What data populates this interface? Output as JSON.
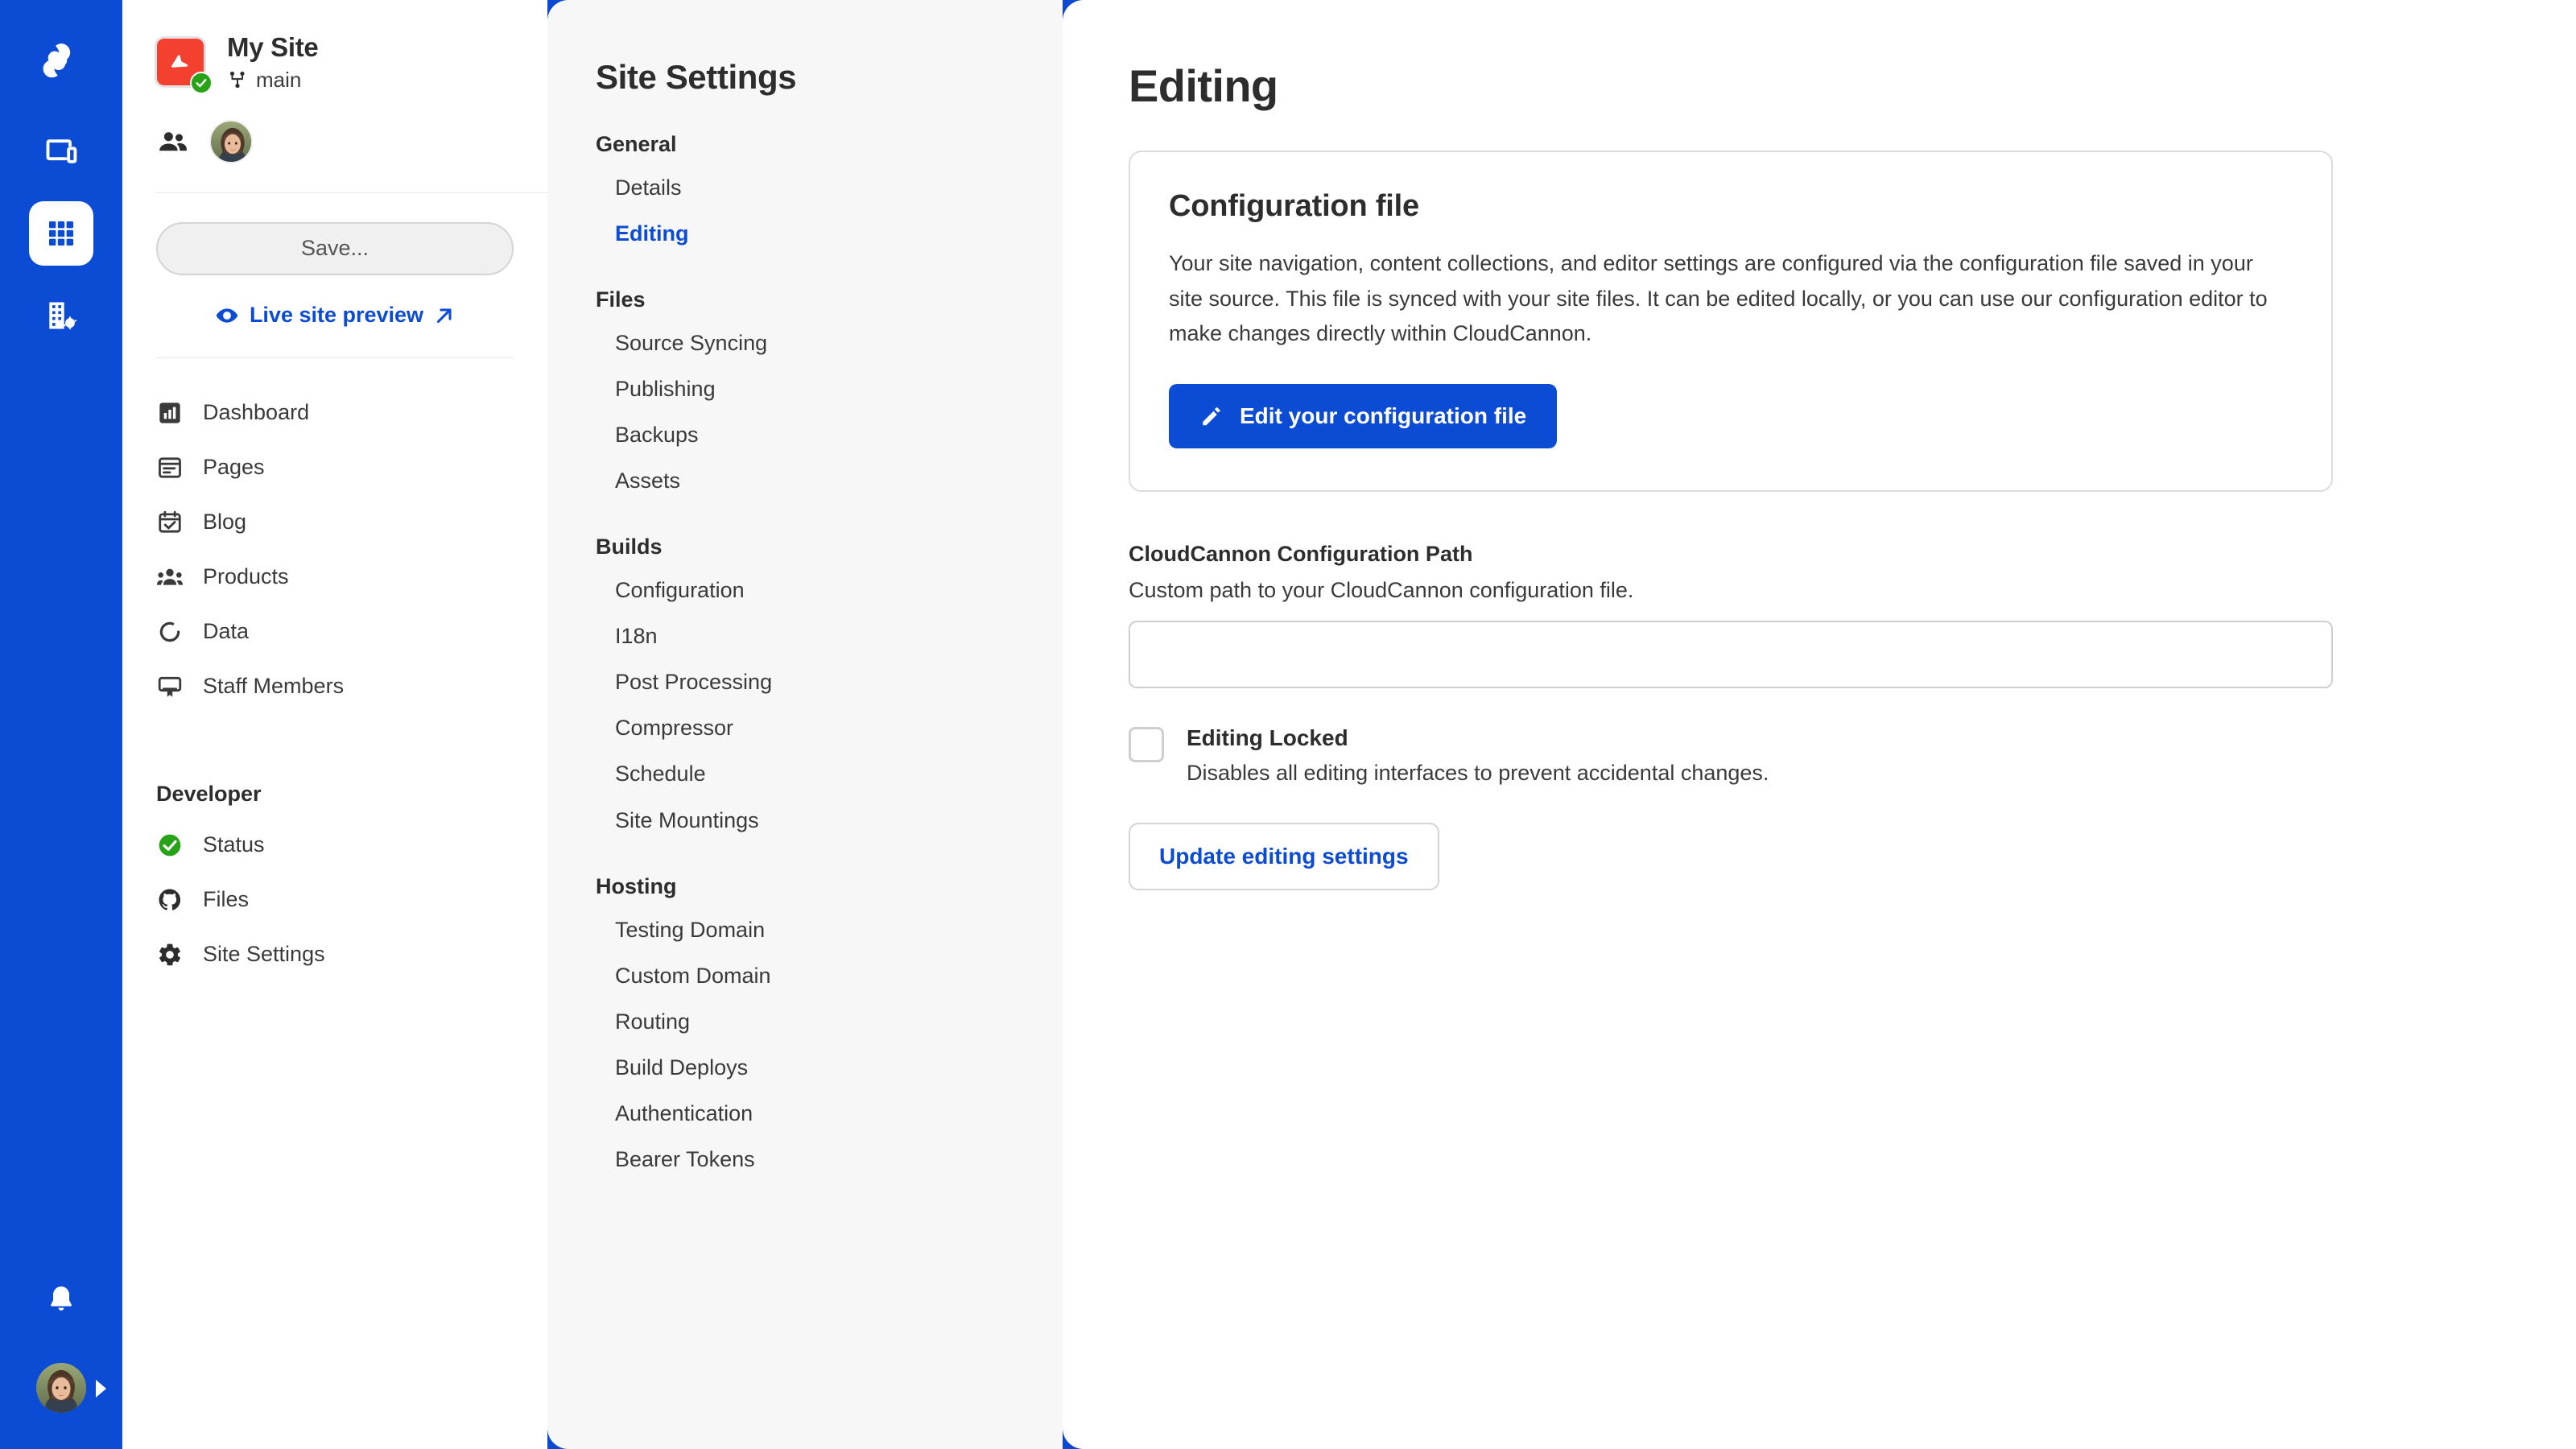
{
  "colors": {
    "brand_blue": "#0c4cd4",
    "site_thumb_red": "#f4402e",
    "status_green": "#26a317",
    "settings_panel_bg": "#f7f7f7",
    "text_dark": "#2d2d2d",
    "border_gray": "#dcdcdc"
  },
  "rail": {
    "logo_icon": "cloudcannon-logo-icon",
    "items": [
      {
        "icon": "devices-preview-icon",
        "active": false
      },
      {
        "icon": "apps-grid-icon",
        "active": true
      },
      {
        "icon": "organisation-settings-icon",
        "active": false
      }
    ],
    "bell_icon": "notifications-bell-icon",
    "avatar_icon": "user-avatar",
    "expand_icon": "expand-caret-icon"
  },
  "site": {
    "name": "My Site",
    "branch": "main",
    "branch_icon": "git-branch-icon",
    "status_icon": "check-circle-icon",
    "members_icon": "people-icon",
    "save_label": "Save...",
    "live_preview_label": "Live site preview",
    "live_preview_eye_icon": "eye-icon",
    "live_preview_external_icon": "external-link-arrow-icon"
  },
  "sidebar": {
    "items": [
      {
        "label": "Dashboard",
        "icon": "dashboard-chart-icon"
      },
      {
        "label": "Pages",
        "icon": "pages-document-icon"
      },
      {
        "label": "Blog",
        "icon": "blog-calendar-check-icon"
      },
      {
        "label": "Products",
        "icon": "products-people-icon"
      },
      {
        "label": "Data",
        "icon": "data-circle-icon"
      },
      {
        "label": "Staff Members",
        "icon": "staff-members-icon"
      }
    ],
    "developer_title": "Developer",
    "developer_items": [
      {
        "label": "Status",
        "icon": "status-check-circle-icon"
      },
      {
        "label": "Files",
        "icon": "github-octocat-icon"
      },
      {
        "label": "Site Settings",
        "icon": "gear-icon"
      }
    ]
  },
  "settings_nav": {
    "title": "Site Settings",
    "groups": [
      {
        "title": "General",
        "links": [
          {
            "label": "Details",
            "active": false
          },
          {
            "label": "Editing",
            "active": true
          }
        ]
      },
      {
        "title": "Files",
        "links": [
          {
            "label": "Source Syncing",
            "active": false
          },
          {
            "label": "Publishing",
            "active": false
          },
          {
            "label": "Backups",
            "active": false
          },
          {
            "label": "Assets",
            "active": false
          }
        ]
      },
      {
        "title": "Builds",
        "links": [
          {
            "label": "Configuration",
            "active": false
          },
          {
            "label": "I18n",
            "active": false
          },
          {
            "label": "Post Processing",
            "active": false
          },
          {
            "label": "Compressor",
            "active": false
          },
          {
            "label": "Schedule",
            "active": false
          },
          {
            "label": "Site Mountings",
            "active": false
          }
        ]
      },
      {
        "title": "Hosting",
        "links": [
          {
            "label": "Testing Domain",
            "active": false
          },
          {
            "label": "Custom Domain",
            "active": false
          },
          {
            "label": "Routing",
            "active": false
          },
          {
            "label": "Build Deploys",
            "active": false
          },
          {
            "label": "Authentication",
            "active": false
          },
          {
            "label": "Bearer Tokens",
            "active": false
          }
        ]
      }
    ]
  },
  "main": {
    "page_title": "Editing",
    "card": {
      "title": "Configuration file",
      "body": "Your site navigation, content collections, and editor settings are configured via the configuration file saved in your site source. This file is synced with your site files. It can be edited locally, or you can use our configuration editor to make changes directly within CloudCannon.",
      "button_label": "Edit your configuration file",
      "button_icon": "pencil-edit-icon"
    },
    "config_path": {
      "label": "CloudCannon Configuration Path",
      "help": "Custom path to your CloudCannon configuration file.",
      "value": "",
      "placeholder": ""
    },
    "editing_locked": {
      "label": "Editing Locked",
      "help": "Disables all editing interfaces to prevent accidental changes.",
      "checked": false
    },
    "update_button_label": "Update editing settings"
  }
}
